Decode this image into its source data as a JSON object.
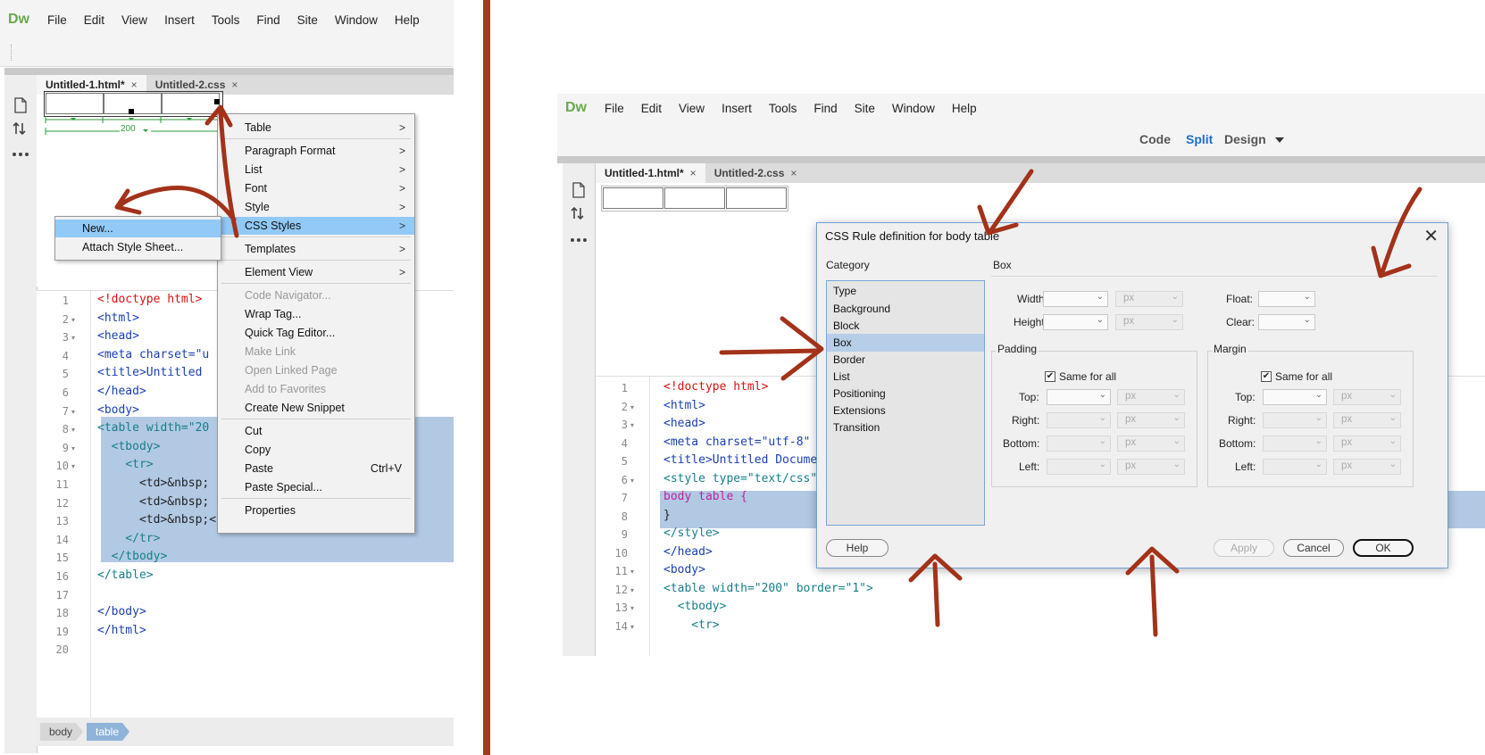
{
  "left": {
    "app_logo": "Dw",
    "menu": [
      "File",
      "Edit",
      "View",
      "Insert",
      "Tools",
      "Find",
      "Site",
      "Window",
      "Help"
    ],
    "tabs": [
      {
        "label": "Untitled-1.html*",
        "close": "×"
      },
      {
        "label": "Untitled-2.css",
        "close": "×"
      }
    ],
    "width_indicator": "200",
    "code_lines": [
      "<!doctype html>",
      "<html>",
      "<head>",
      "<meta charset=\"u",
      "<title>Untitled",
      "</head>",
      "<body>",
      "<table width=\"20",
      "  <tbody>",
      "    <tr>",
      "      <td>&nbsp;",
      "      <td>&nbsp;",
      "      <td>&nbsp;</td>",
      "    </tr>",
      "  </tbody>",
      "</table>",
      "",
      "</body>",
      "</html>",
      ""
    ],
    "line_numbers": [
      "1",
      "2",
      "3",
      "4",
      "5",
      "6",
      "7",
      "8",
      "9",
      "10",
      "11",
      "12",
      "13",
      "14",
      "15",
      "16",
      "17",
      "18",
      "19",
      "20"
    ],
    "tag_selector": [
      "body",
      "table"
    ],
    "context_menu": [
      {
        "label": "Table",
        "submenu": true
      },
      {
        "label": "Paragraph Format",
        "submenu": true
      },
      {
        "label": "List",
        "submenu": true
      },
      {
        "label": "Font",
        "submenu": true
      },
      {
        "label": "Style",
        "submenu": true
      },
      {
        "label": "CSS Styles",
        "submenu": true,
        "highlighted": true
      },
      {
        "label": "Templates",
        "submenu": true
      },
      {
        "label": "Element View",
        "submenu": true
      },
      {
        "label": "Code Navigator...",
        "disabled": true
      },
      {
        "label": "Wrap Tag..."
      },
      {
        "label": "Quick Tag Editor..."
      },
      {
        "label": "Make Link",
        "disabled": true
      },
      {
        "label": "Open Linked Page",
        "disabled": true
      },
      {
        "label": "Add to Favorites",
        "disabled": true
      },
      {
        "label": "Create New Snippet"
      },
      {
        "label": "Cut"
      },
      {
        "label": "Copy"
      },
      {
        "label": "Paste",
        "shortcut": "Ctrl+V"
      },
      {
        "label": "Paste Special..."
      },
      {
        "label": "Properties"
      }
    ],
    "submenu_arrow": ">",
    "css_submenu": [
      {
        "label": "New...",
        "highlighted": true
      },
      {
        "label": "Attach Style Sheet..."
      }
    ]
  },
  "right": {
    "app_logo": "Dw",
    "menu": [
      "File",
      "Edit",
      "View",
      "Insert",
      "Tools",
      "Find",
      "Site",
      "Window",
      "Help"
    ],
    "view_buttons": [
      {
        "label": "Code"
      },
      {
        "label": "Split",
        "active": true
      },
      {
        "label": "Design"
      }
    ],
    "tabs": [
      {
        "label": "Untitled-1.html*",
        "close": "×"
      },
      {
        "label": "Untitled-2.css",
        "close": "×"
      }
    ],
    "code_lines": [
      "<!doctype html>",
      "<html>",
      "<head>",
      "<meta charset=\"utf-8\"",
      "<title>Untitled Docume",
      "<style type=\"text/css\"",
      "body table {",
      "}",
      "</style>",
      "</head>",
      "<body>",
      "<table width=\"200\" border=\"1\">",
      "  <tbody>",
      "    <tr>"
    ],
    "line_numbers": [
      "1",
      "2",
      "3",
      "4",
      "5",
      "6",
      "7",
      "8",
      "9",
      "10",
      "11",
      "12",
      "13",
      "14"
    ],
    "dialog": {
      "title": "CSS Rule definition for body table",
      "close": "✕",
      "category_header": "Category",
      "categories": [
        "Type",
        "Background",
        "Block",
        "Box",
        "Border",
        "List",
        "Positioning",
        "Extensions",
        "Transition"
      ],
      "selected_category": "Box",
      "section_header": "Box",
      "width_label": "Width:",
      "height_label": "Height:",
      "float_label": "Float:",
      "clear_label": "Clear:",
      "unit": "px",
      "padding": {
        "title": "Padding",
        "same_for_all": "Same for all",
        "checked": true,
        "sides": [
          "Top:",
          "Right:",
          "Bottom:",
          "Left:"
        ]
      },
      "margin": {
        "title": "Margin",
        "same_for_all": "Same for all",
        "checked": true,
        "sides": [
          "Top:",
          "Right:",
          "Bottom:",
          "Left:"
        ]
      },
      "check_mark": "✔",
      "buttons": {
        "help": "Help",
        "apply": "Apply",
        "cancel": "Cancel",
        "ok": "OK"
      }
    }
  },
  "colors": {
    "divider": "#a33a1c",
    "arrows": "#a3321a",
    "selection": "#b2c9e4",
    "menu_highlight": "#91c9f7",
    "active_view": "#1f6fd1",
    "dw_logo": "#6aa84f"
  },
  "icons": [
    "new-document-icon",
    "file-transfer-icon",
    "more-icon",
    "chevron-right-icon",
    "chevron-down-icon",
    "close-icon",
    "checkbox-icon"
  ]
}
